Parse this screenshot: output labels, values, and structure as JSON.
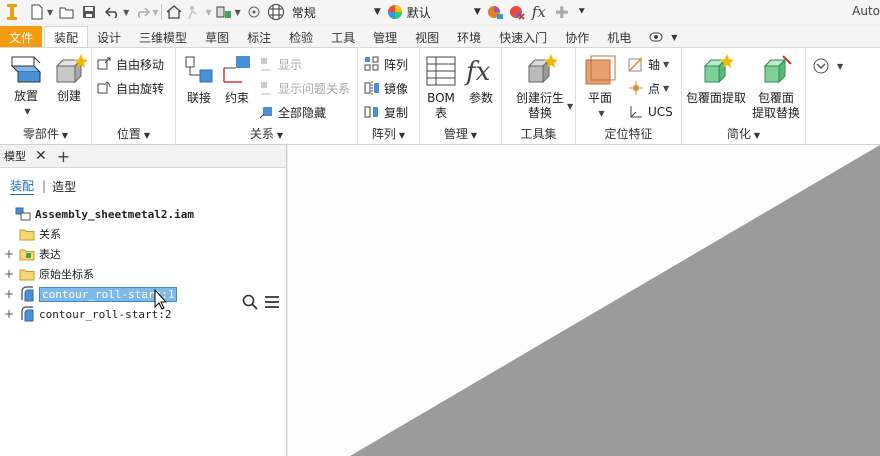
{
  "qat": {
    "style_value": "常规",
    "appearance_value": "默认",
    "fx_label": "fx",
    "app_title": "Auto"
  },
  "tabs": [
    "文件",
    "装配",
    "设计",
    "三维模型",
    "草图",
    "标注",
    "检验",
    "工具",
    "管理",
    "视图",
    "环境",
    "快速入门",
    "协作",
    "机电"
  ],
  "active_tab_index": 1,
  "ribbon": {
    "components": {
      "place": "放置",
      "create": "创建",
      "label": "零部件"
    },
    "position": {
      "free_move": "自由移动",
      "free_rotate": "自由旋转",
      "label": "位置"
    },
    "relationships": {
      "joint": "联接",
      "constrain": "约束",
      "show": "显示",
      "show_sick": "显示问题关系",
      "hide_all": "全部隐藏",
      "label": "关系"
    },
    "pattern": {
      "pattern": "阵列",
      "mirror": "镜像",
      "copy": "复制",
      "label": "阵列"
    },
    "manage": {
      "bom_line1": "BOM",
      "bom_line2": "表",
      "params": "参数",
      "label": "管理"
    },
    "productivity": {
      "derive_line1": "创建衍生",
      "derive_line2": "替换",
      "label": "工具集"
    },
    "work_features": {
      "plane": "平面",
      "axis": "轴",
      "point": "点",
      "ucs": "UCS",
      "label": "定位特征"
    },
    "simplification": {
      "shrinkwrap": "包覆面提取",
      "sw_sub_line1": "包覆面",
      "sw_sub_line2": "提取替换",
      "label": "简化"
    }
  },
  "browser": {
    "tab_label": "模型",
    "sub_assembly": "装配",
    "sub_modeling": "造型",
    "tree": [
      {
        "label": "Assembly_sheetmetal2.iam",
        "type": "root"
      },
      {
        "label": "关系",
        "type": "folder"
      },
      {
        "label": "表达",
        "type": "folder-expandable"
      },
      {
        "label": "原始坐标系",
        "type": "folder-expandable"
      },
      {
        "label": "contour_roll-start:1",
        "type": "part",
        "selected": true
      },
      {
        "label": "contour_roll-start:2",
        "type": "part"
      }
    ]
  },
  "colors": {
    "file_tab": "#f39c12",
    "selection": "#7fb9e8",
    "viewport_shape": "#9b9b9b"
  }
}
